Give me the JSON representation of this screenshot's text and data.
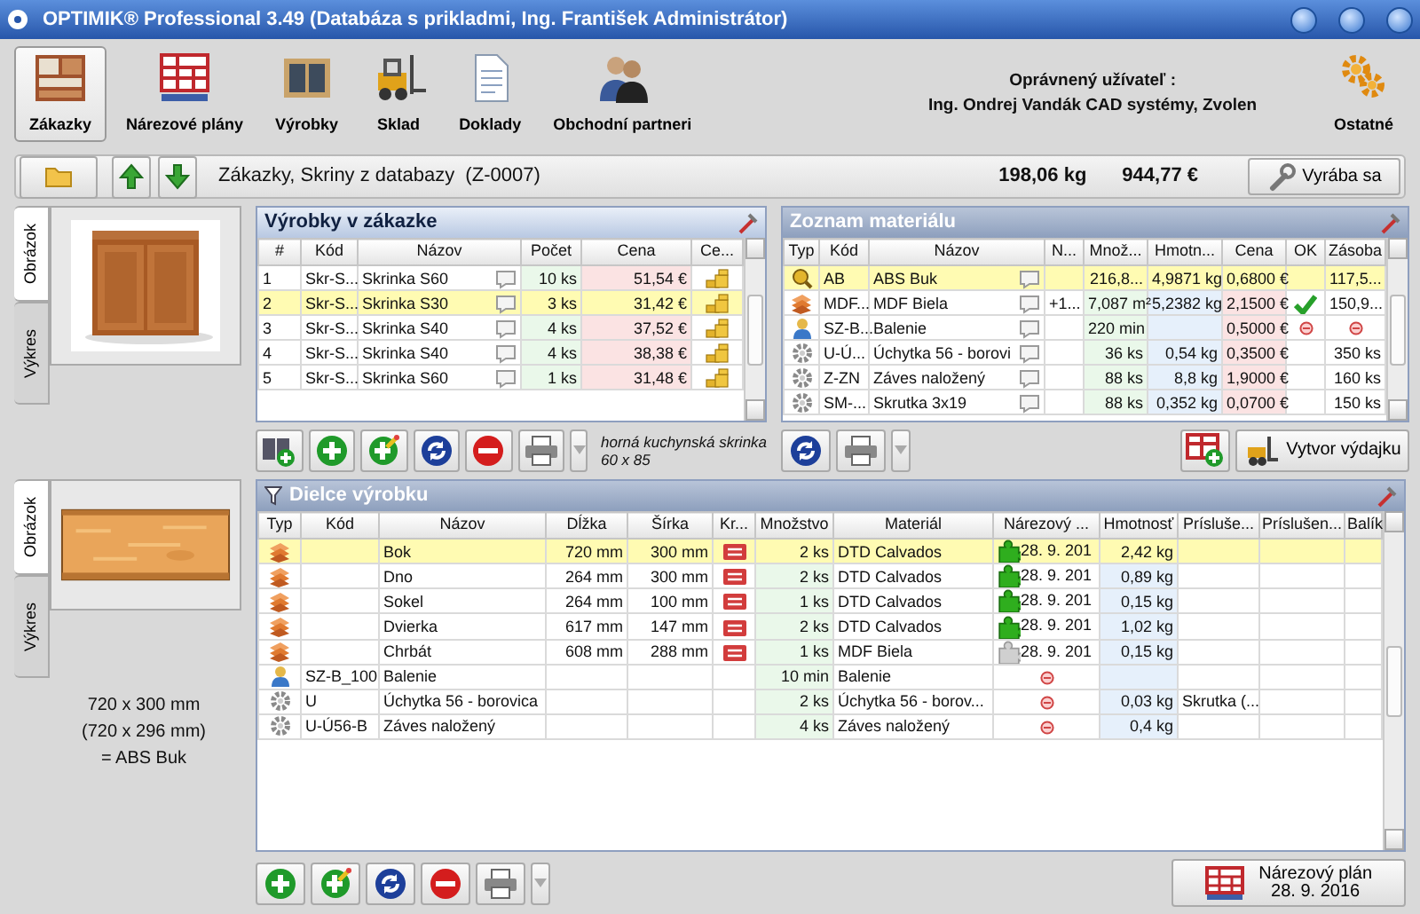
{
  "window": {
    "title": "OPTIMIK® Professional 3.49  (Databáza s prikladmi, Ing. František Administrátor)"
  },
  "toolbar": {
    "items": [
      {
        "kind": "orders",
        "label": "Zákazky",
        "selected": true
      },
      {
        "kind": "plans",
        "label": "Nárezové plány",
        "selected": false
      },
      {
        "kind": "products",
        "label": "Výrobky",
        "selected": false
      },
      {
        "kind": "warehouse",
        "label": "Sklad",
        "selected": false
      },
      {
        "kind": "documents",
        "label": "Doklady",
        "selected": false
      },
      {
        "kind": "partners",
        "label": "Obchodní partneri",
        "selected": false
      }
    ],
    "user_label": "Oprávnený užívateľ :",
    "user_name": "Ing. Ondrej Vandák CAD systémy, Zvolen",
    "settings_label": "Ostatné"
  },
  "order_bar": {
    "title": "Zákazky, Skriny z databazy  (Z-0007)",
    "weight": "198,06 kg",
    "price": "944,77 €",
    "status_button": "Vyrába sa"
  },
  "product_view": {
    "tabs": [
      {
        "label": "Obrázok",
        "selected": true
      },
      {
        "label": "Výkres",
        "selected": false
      }
    ]
  },
  "products": {
    "title": "Výrobky v zákazke",
    "columns": [
      "#",
      "Kód",
      "Názov",
      "Počet",
      "Cena",
      "Ce..."
    ],
    "rows": [
      {
        "num": "1",
        "code": "Skr-S...",
        "name": "Skrinka S60",
        "count": "10 ks",
        "price": "51,54 €",
        "selected": false
      },
      {
        "num": "2",
        "code": "Skr-S...",
        "name": "Skrinka S30",
        "count": "3 ks",
        "price": "31,42 €",
        "selected": true
      },
      {
        "num": "3",
        "code": "Skr-S...",
        "name": "Skrinka S40",
        "count": "4 ks",
        "price": "37,52 €",
        "selected": false
      },
      {
        "num": "4",
        "code": "Skr-S...",
        "name": "Skrinka S40",
        "count": "4 ks",
        "price": "38,38 €",
        "selected": false
      },
      {
        "num": "5",
        "code": "Skr-S...",
        "name": "Skrinka S60",
        "count": "1 ks",
        "price": "31,48 €",
        "selected": false
      }
    ],
    "note_lines": [
      "horná kuchynská skrinka",
      "60 x 85"
    ]
  },
  "materials": {
    "title": "Zoznam materiálu",
    "columns": [
      "Typ",
      "Kód",
      "Názov",
      "N...",
      "Množ...",
      "Hmotn...",
      "Cena",
      "OK",
      "Zásoba"
    ],
    "rows": [
      {
        "kind": "edge",
        "code": "AB",
        "name": "ABS Buk",
        "qty": "216,8...",
        "weight": "4,9871 kg",
        "price": "0,6800 €",
        "approved": false,
        "unavailable": false,
        "stock": "117,5...",
        "selected": true
      },
      {
        "kind": "board",
        "code": "MDF...",
        "name": "MDF Biela",
        "n": "+1...",
        "qty": "7,087 m²",
        "weight": "5,2382 kg",
        "price": "2,1500 €",
        "approved": true,
        "unavailable": false,
        "stock": "150,9...",
        "selected": false
      },
      {
        "kind": "service",
        "code": "SZ-B...",
        "name": "Balenie",
        "qty": "220 min",
        "price": "0,5000 €",
        "approved": false,
        "unavailable": true,
        "selected": false
      },
      {
        "kind": "hardware",
        "code": "U-Ú...",
        "name": "Úchytka 56 - borovi",
        "qty": "36 ks",
        "weight": "0,54 kg",
        "price": "0,3500 €",
        "approved": false,
        "unavailable": false,
        "stock": "350 ks",
        "selected": false
      },
      {
        "kind": "hardware",
        "code": "Z-ZN",
        "name": "Záves naložený",
        "qty": "88 ks",
        "weight": "8,8 kg",
        "price": "1,9000 €",
        "approved": false,
        "unavailable": false,
        "stock": "160 ks",
        "selected": false
      },
      {
        "kind": "hardware",
        "code": "SM-...",
        "name": "Skrutka 3x19",
        "qty": "88 ks",
        "weight": "0,352 kg",
        "price": "0,0700 €",
        "approved": false,
        "unavailable": false,
        "stock": "150 ks",
        "selected": false
      }
    ],
    "issue_button": "Vytvor výdajku"
  },
  "part_view": {
    "tabs": [
      {
        "label": "Obrázok",
        "selected": true
      },
      {
        "label": "Výkres",
        "selected": false
      }
    ],
    "dimensions": "720 x 300 mm",
    "net_dimensions": "(720 x 296 mm)",
    "edge": "= ABS Buk"
  },
  "parts": {
    "title": "Dielce výrobku",
    "columns": [
      "Typ",
      "Kód",
      "Názov",
      "Dĺžka",
      "Šírka",
      "Kr...",
      "Množstvo",
      "Materiál",
      "Nárezový ...",
      "Hmotnosť",
      "Prísluše...",
      "Príslušen...",
      "Balík"
    ],
    "rows": [
      {
        "kind": "board",
        "name": "Bok",
        "length": "720 mm",
        "width": "300 mm",
        "edged": true,
        "qty": "2 ks",
        "material": "DTD Calvados",
        "in_plan": true,
        "plan_complete": true,
        "plan_date": "28. 9. 201",
        "weight": "2,42 kg",
        "selected": true
      },
      {
        "kind": "board",
        "name": "Dno",
        "length": "264 mm",
        "width": "300 mm",
        "edged": true,
        "qty": "2 ks",
        "material": "DTD Calvados",
        "in_plan": true,
        "plan_complete": true,
        "plan_date": "28. 9. 201",
        "weight": "0,89 kg",
        "selected": false
      },
      {
        "kind": "board",
        "name": "Sokel",
        "length": "264 mm",
        "width": "100 mm",
        "edged": true,
        "qty": "1 ks",
        "material": "DTD Calvados",
        "in_plan": true,
        "plan_complete": true,
        "plan_date": "28. 9. 201",
        "weight": "0,15 kg",
        "selected": false
      },
      {
        "kind": "board",
        "name": "Dvierka",
        "length": "617 mm",
        "width": "147 mm",
        "edged": true,
        "qty": "2 ks",
        "material": "DTD Calvados",
        "in_plan": true,
        "plan_complete": true,
        "plan_date": "28. 9. 201",
        "weight": "1,02 kg",
        "selected": false
      },
      {
        "kind": "board",
        "name": "Chrbát",
        "length": "608 mm",
        "width": "288 mm",
        "edged": true,
        "qty": "1 ks",
        "material": "MDF Biela",
        "in_plan": true,
        "plan_complete": false,
        "plan_date": "28. 9. 201",
        "weight": "0,15 kg",
        "selected": false
      },
      {
        "kind": "service",
        "code": "SZ-B_100",
        "name": "Balenie",
        "edged": false,
        "qty": "10 min",
        "material": "Balenie",
        "in_plan": false,
        "selected": false
      },
      {
        "kind": "hardware",
        "code": "U",
        "name": "Úchytka 56 - borovica",
        "edged": false,
        "qty": "2 ks",
        "material": "Úchytka 56 - borov...",
        "in_plan": false,
        "weight": "0,03 kg",
        "accessory": "Skrutka (...",
        "selected": false
      },
      {
        "kind": "hardware",
        "code": "U-Ú56-B",
        "name": "Záves naložený",
        "edged": false,
        "qty": "4 ks",
        "material": "Záves naložený",
        "in_plan": false,
        "weight": "0,4 kg",
        "selected": false
      }
    ]
  },
  "cutting_plan": {
    "label": "Nárezový plán",
    "date": "28. 9. 2016"
  }
}
